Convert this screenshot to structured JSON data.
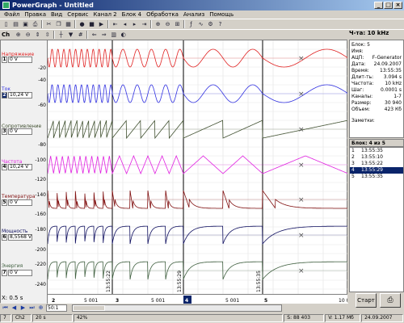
{
  "window": {
    "title": "PowerGraph - Untitled"
  },
  "menu": [
    "Файл",
    "Правка",
    "Вид",
    "Сервис",
    "Канал 2",
    "Блок 4",
    "Обработка",
    "Анализ",
    "Помощь"
  ],
  "toolbar": {
    "channel_label": "Ch",
    "freq_label": "Ч-та: 10 kHz"
  },
  "channels": [
    {
      "num": "1",
      "name": "Напряжение",
      "value": "0 V",
      "color": "#e02020",
      "yticks": [
        "-20",
        "-40"
      ]
    },
    {
      "num": "2",
      "name": "Ток",
      "value": "10,24 V",
      "color": "#3030e0",
      "yticks": [
        "-60"
      ]
    },
    {
      "num": "3",
      "name": "Сопротивление",
      "value": "0 V",
      "color": "#405030",
      "yticks": [
        "-80"
      ]
    },
    {
      "num": "4",
      "name": "Частота",
      "value": "10,24 V",
      "color": "#e020e0",
      "yticks": [
        "-100",
        "-120"
      ]
    },
    {
      "num": "5",
      "name": "Температура",
      "value": "0 V",
      "color": "#801010",
      "yticks": [
        "-140",
        "-160"
      ]
    },
    {
      "num": "6",
      "name": "Мощность",
      "value": "8,5568 V",
      "color": "#101060",
      "yticks": [
        "-180",
        "-200"
      ]
    },
    {
      "num": "7",
      "name": "Энергия",
      "value": "0 V",
      "color": "#406040",
      "yticks": [
        "-220",
        "-240"
      ]
    }
  ],
  "xaxis": {
    "ticks": [
      "2",
      "5 001",
      "3",
      "5 001",
      "4",
      "5 001",
      "5",
      "10 00"
    ],
    "markers": [
      "13:55:22",
      "13:55:29",
      "13:55:35"
    ]
  },
  "info": {
    "title": "Блок: 5",
    "rows": [
      [
        "Имя:",
        ""
      ],
      [
        "АЦП:",
        "F-Generator"
      ],
      [
        "Дата:",
        "24.09.2007"
      ],
      [
        "Время:",
        "13:55:35"
      ],
      [
        "Длит-ть:",
        "3.094 s"
      ],
      [
        "Частота:",
        "10 kHz"
      ],
      [
        "Шаг:",
        "0.0001 s"
      ],
      [
        "Каналы:",
        "1-7"
      ],
      [
        "Размер:",
        "30 940"
      ],
      [
        "Объем:",
        "423 Кб"
      ]
    ],
    "notes_label": "Заметки:"
  },
  "blocks": {
    "header": "Блок: 4 из 5",
    "items": [
      {
        "num": "1",
        "time": "13:55:35"
      },
      {
        "num": "2",
        "time": "13:55:10"
      },
      {
        "num": "3",
        "time": "13:55:22"
      },
      {
        "num": "4",
        "time": "13:55:29"
      },
      {
        "num": "5",
        "time": "13:55:35"
      }
    ],
    "selected_index": 3
  },
  "buttons": {
    "start": "Старт"
  },
  "zoom": {
    "label": "X: 0.5 s",
    "scale": "50:1"
  },
  "status": [
    "7",
    "Ch2",
    "20 s",
    "42%",
    "S: 88 403",
    "V: 1.17 Мб",
    "24.09.2007"
  ]
}
